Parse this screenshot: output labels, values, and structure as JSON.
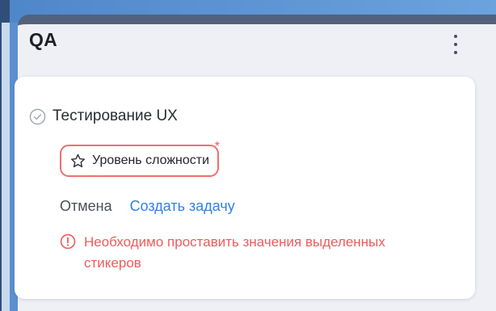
{
  "column": {
    "title": "QA",
    "menu_icon": "more-vertical-icon"
  },
  "card": {
    "task_title": "Тестирование UX",
    "status_icon": "check-circle-icon",
    "sticker": {
      "icon": "star-icon",
      "label": "Уровень сложности",
      "required": "*"
    },
    "actions": {
      "cancel_label": "Отмена",
      "create_label": "Создать задачу"
    },
    "error": {
      "icon": "alert-circle-icon",
      "message": "Необходимо проставить значения выделенных стикеров"
    }
  },
  "colors": {
    "accent": "#2f80e8",
    "error": "#ef5b5b",
    "column_header": "#52627d",
    "background": "#5b8fcf"
  }
}
